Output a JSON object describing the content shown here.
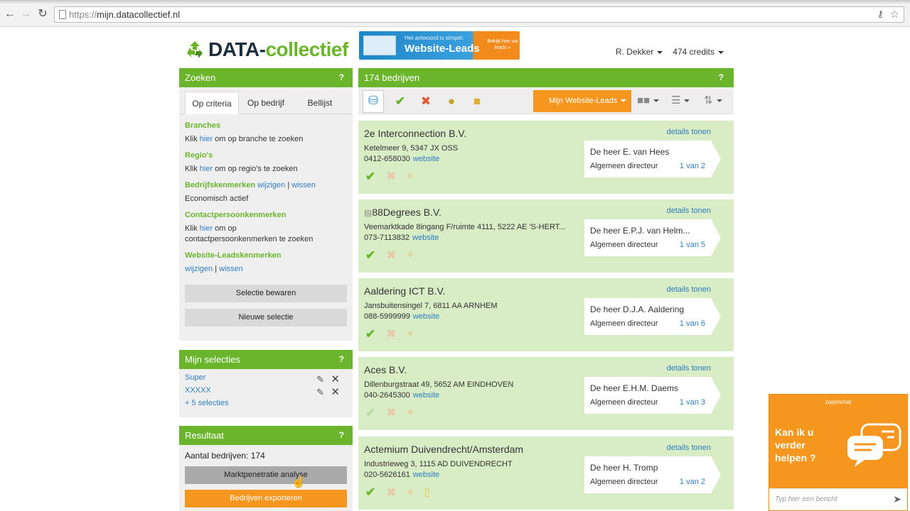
{
  "browser": {
    "url_scheme": "https://",
    "url_host": "mijn.datacollectief.nl",
    "back_icon": "arrow-left",
    "forward_icon": "arrow-right",
    "reload_icon": "reload"
  },
  "header": {
    "logo_main": "DATA-",
    "logo_sub": "collectief",
    "banner_line1": "Het antwoord is simpel:",
    "banner_line2": "Website-Leads",
    "banner_cta": "Bekijk hier uw leads »",
    "user_name": "R. Dekker",
    "credits": "474 credits"
  },
  "search": {
    "title": "Zoeken",
    "help": "?",
    "tabs": [
      "Op criteria",
      "Op bedrijf",
      "Bellijst"
    ],
    "branches_h": "Branches",
    "branches_pre": "Klik ",
    "branches_link": "hier",
    "branches_post": " om op branche te zoeken",
    "regio_h": "Regio's",
    "regio_pre": "Klik ",
    "regio_link": "hier",
    "regio_post": " om op regio's te zoeken",
    "bedrijf_h": "Bedrijfskenmerken",
    "bedrijf_wijzigen": "wijzigen",
    "bedrijf_sep": "|",
    "bedrijf_wissen": "wissen",
    "bedrijf_value": "Economisch actief",
    "contact_h": "Contactpersoonkenmerken",
    "contact_pre": "Klik ",
    "contact_link": "hier",
    "contact_post": " om op contactpersoonkenmerken te zoeken",
    "leads_h": "Website-Leadskenmerken",
    "leads_wijzigen": "wijzigen",
    "leads_sep": "|",
    "leads_wissen": "wissen",
    "save_btn": "Selectie bewaren",
    "new_btn": "Nieuwe selectie"
  },
  "selections": {
    "title": "Mijn selecties",
    "help": "?",
    "items": [
      "Super",
      "XXXXX"
    ],
    "more": "+ 5 selecties"
  },
  "result": {
    "title": "Resultaat",
    "help": "?",
    "count_label": "Aantal bedrijven: 174",
    "analyse_btn": "Marktpenetratie analyse",
    "export_btn": "Bedrijven exporteren"
  },
  "list": {
    "title": "174 bedrijven",
    "help": "?",
    "leads_dropdown": "Mijn Website-Leads",
    "details_label": "details tonen",
    "website_label": "website",
    "companies": [
      {
        "name": "2e Interconnection B.V.",
        "address": "Ketelmeer 9, 5347 JX OSS",
        "phone": "0412-658030",
        "contact": "De heer E. van Hees",
        "role": "Algemeen directeur",
        "page": "1 van 2"
      },
      {
        "name": "88Degrees B.V.",
        "address": "Veemarktkade 8ingang F/ruimte 4111, 5222 AE 'S-HERT...",
        "phone": "073-7113832",
        "contact": "De heer E.P.J. van Helm...",
        "role": "Algemeen directeur",
        "page": "1 van 5"
      },
      {
        "name": "Aaldering ICT B.V.",
        "address": "Jansbuitensingel 7, 6811 AA ARNHEM",
        "phone": "088-5999999",
        "contact": "De heer D.J.A. Aaldering",
        "role": "Algemeen directeur",
        "page": "1 van 6"
      },
      {
        "name": "Aces B.V.",
        "address": "Dillenburgstraat 49, 5652 AM EINDHOVEN",
        "phone": "040-2645300",
        "contact": "De heer E.H.M. Daems",
        "role": "Algemeen directeur",
        "page": "1 van 3"
      },
      {
        "name": "Actemium Duivendrecht/Amsterdam",
        "address": "Industrieweg 3, 1115 AD DUIVENDRECHT",
        "phone": "020-5626161",
        "contact": "De heer H. Tromp",
        "role": "Algemeen directeur",
        "page": "1 van 2"
      }
    ]
  },
  "chat": {
    "brand": "zopimchat",
    "message": "Kan ik u verder helpen ?",
    "placeholder": "Typ hier een bericht"
  },
  "colors": {
    "green": "#6bb52d",
    "orange": "#f5961e",
    "card_bg": "#d8ecc6",
    "link": "#2f7dc0"
  }
}
